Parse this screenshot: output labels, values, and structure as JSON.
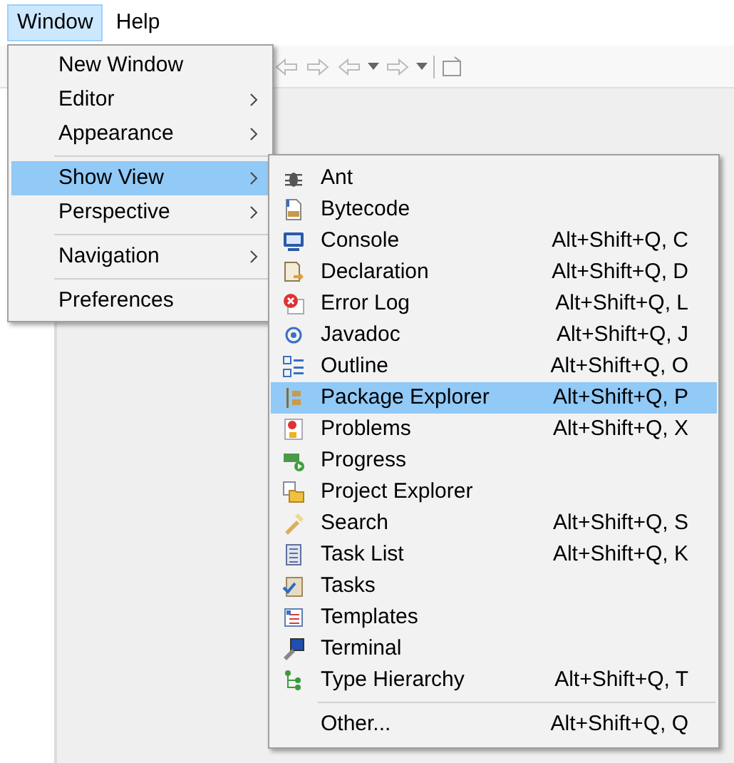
{
  "menubar": [
    {
      "label": "Window",
      "selected": true
    },
    {
      "label": "Help",
      "selected": false
    }
  ],
  "window_menu": [
    {
      "kind": "item",
      "label": "New Window",
      "submenu": false,
      "selected": false
    },
    {
      "kind": "item",
      "label": "Editor",
      "submenu": true,
      "selected": false
    },
    {
      "kind": "item",
      "label": "Appearance",
      "submenu": true,
      "selected": false
    },
    {
      "kind": "separator"
    },
    {
      "kind": "item",
      "label": "Show View",
      "submenu": true,
      "selected": true
    },
    {
      "kind": "item",
      "label": "Perspective",
      "submenu": true,
      "selected": false
    },
    {
      "kind": "separator"
    },
    {
      "kind": "item",
      "label": "Navigation",
      "submenu": true,
      "selected": false
    },
    {
      "kind": "separator"
    },
    {
      "kind": "item",
      "label": "Preferences",
      "submenu": false,
      "selected": false
    }
  ],
  "show_view_menu": [
    {
      "kind": "item",
      "label": "Ant",
      "selected": false
    },
    {
      "kind": "item",
      "label": "Bytecode",
      "selected": false
    },
    {
      "kind": "item",
      "label": "Console",
      "shortcut": "Alt+Shift+Q, C",
      "selected": false
    },
    {
      "kind": "item",
      "label": "Declaration",
      "shortcut": "Alt+Shift+Q, D",
      "selected": false
    },
    {
      "kind": "item",
      "label": "Error Log",
      "shortcut": "Alt+Shift+Q, L",
      "selected": false
    },
    {
      "kind": "item",
      "label": "Javadoc",
      "shortcut": "Alt+Shift+Q, J",
      "selected": false
    },
    {
      "kind": "item",
      "label": "Outline",
      "shortcut": "Alt+Shift+Q, O",
      "selected": false
    },
    {
      "kind": "item",
      "label": "Package Explorer",
      "shortcut": "Alt+Shift+Q, P",
      "selected": true
    },
    {
      "kind": "item",
      "label": "Problems",
      "shortcut": "Alt+Shift+Q, X",
      "selected": false
    },
    {
      "kind": "item",
      "label": "Progress",
      "selected": false
    },
    {
      "kind": "item",
      "label": "Project Explorer",
      "selected": false
    },
    {
      "kind": "item",
      "label": "Search",
      "shortcut": "Alt+Shift+Q, S",
      "selected": false
    },
    {
      "kind": "item",
      "label": "Task List",
      "shortcut": "Alt+Shift+Q, K",
      "selected": false
    },
    {
      "kind": "item",
      "label": "Tasks",
      "selected": false
    },
    {
      "kind": "item",
      "label": "Templates",
      "selected": false
    },
    {
      "kind": "item",
      "label": "Terminal",
      "selected": false
    },
    {
      "kind": "item",
      "label": "Type Hierarchy",
      "shortcut": "Alt+Shift+Q, T",
      "selected": false
    },
    {
      "kind": "separator"
    },
    {
      "kind": "item",
      "label": "Other...",
      "shortcut": "Alt+Shift+Q, Q",
      "selected": false
    }
  ]
}
